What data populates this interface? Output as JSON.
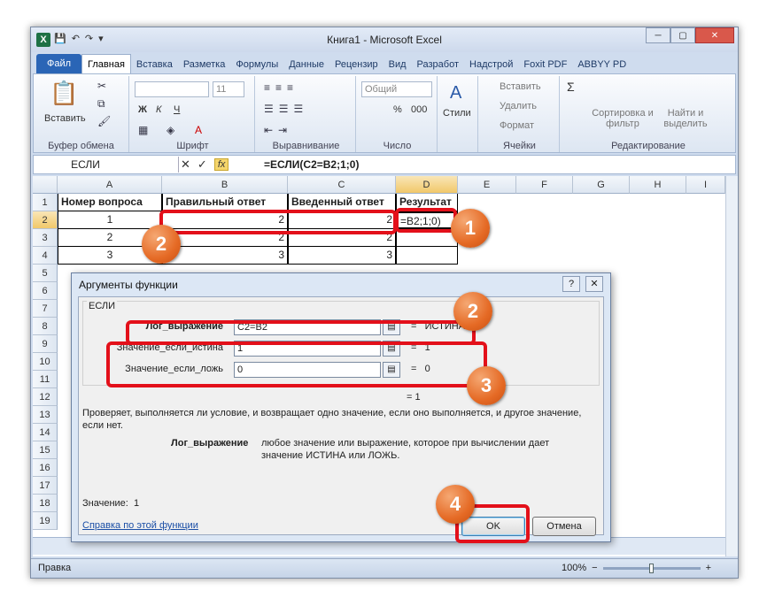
{
  "window": {
    "title": "Книга1  -  Microsoft Excel",
    "logo": "X",
    "qat": [
      "💾",
      "↶",
      "↷",
      "▾"
    ],
    "min": "─",
    "max": "▢",
    "close": "✕"
  },
  "tabs": [
    "Файл",
    "Главная",
    "Вставка",
    "Разметка",
    "Формулы",
    "Данные",
    "Рецензир",
    "Вид",
    "Разработ",
    "Надстрой",
    "Foxit PDF",
    "ABBYY PD"
  ],
  "ribbon": {
    "paste": "Вставить",
    "clipboard": "Буфер обмена",
    "font_size": "11",
    "font_group": "Шрифт",
    "bold": "Ж",
    "italic": "К",
    "underline": "Ч",
    "align_group": "Выравнивание",
    "number_format": "Общий",
    "percent": "%",
    "thousands": "000",
    "number_group": "Число",
    "styles": "Стили",
    "insert": "Вставить",
    "delete": "Удалить",
    "format": "Формат",
    "cells_group": "Ячейки",
    "sigma": "Σ",
    "sort": "Сортировка и фильтр",
    "find": "Найти и выделить",
    "edit_group": "Редактирование"
  },
  "formula_bar": {
    "name": "ЕСЛИ",
    "cancel": "✕",
    "enter": "✓",
    "fx": "fx",
    "formula": "=ЕСЛИ(C2=B2;1;0)"
  },
  "columns": [
    "A",
    "B",
    "C",
    "D",
    "E",
    "F",
    "G",
    "H",
    "I"
  ],
  "rows": [
    "1",
    "2",
    "3",
    "4",
    "5",
    "6",
    "7",
    "8",
    "9",
    "10",
    "11",
    "12",
    "13",
    "14",
    "15",
    "16",
    "17",
    "18",
    "19"
  ],
  "cells": {
    "a1": "Номер вопроса",
    "b1": "Правильный ответ",
    "c1": "Введенный ответ",
    "d1": "Результат",
    "a2": "1",
    "b2": "2",
    "c2": "2",
    "d2": "=B2;1;0)",
    "a3": "2",
    "b3": "2",
    "c3": "2",
    "a4": "3",
    "b4": "3",
    "c4": "3"
  },
  "sheet": {
    "status": "Правка",
    "zoom": "100%",
    "minus": "−",
    "plus": "+"
  },
  "dialog": {
    "title": "Аргументы функции",
    "help": "?",
    "close": "✕",
    "func": "ЕСЛИ",
    "args": [
      {
        "label": "Лог_выражение",
        "value": "C2=B2",
        "eq": "=",
        "result": "ИСТИНА"
      },
      {
        "label": "Значение_если_истина",
        "value": "1",
        "eq": "=",
        "result": "1"
      },
      {
        "label": "Значение_если_ложь",
        "value": "0",
        "eq": "=",
        "result": "0"
      }
    ],
    "total": "=  1",
    "desc": "Проверяет, выполняется ли условие, и возвращает одно значение, если оно выполняется, и другое значение, если нет.",
    "arg_name": "Лог_выражение",
    "arg_desc": "любое значение или выражение, которое при вычислении дает значение ИСТИНА или ЛОЖЬ.",
    "value_label": "Значение:",
    "value": "1",
    "help_link": "Справка по этой функции",
    "ok": "OK",
    "cancel": "Отмена"
  },
  "badges": [
    "1",
    "2",
    "2",
    "3",
    "4"
  ]
}
